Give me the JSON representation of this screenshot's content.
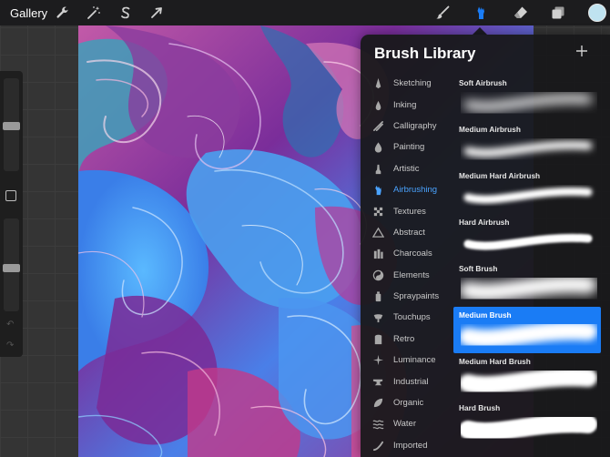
{
  "topbar": {
    "gallery_label": "Gallery",
    "actions_icons": [
      "wrench-icon",
      "magic-wand-icon",
      "selection-s-icon",
      "transform-arrow-icon"
    ],
    "tools_icons": [
      "brush-icon",
      "smudge-icon",
      "eraser-icon",
      "layers-icon"
    ],
    "active_tool": "smudge-icon",
    "accent_color": "#1a7cf5",
    "current_color": "#bfe3f0"
  },
  "panel": {
    "title": "Brush Library",
    "add_icon": "plus-icon",
    "sets": [
      {
        "label": "Sketching",
        "icon": "pencil-icon"
      },
      {
        "label": "Inking",
        "icon": "ink-drop-icon"
      },
      {
        "label": "Calligraphy",
        "icon": "calligraphy-icon"
      },
      {
        "label": "Painting",
        "icon": "paint-drop-icon"
      },
      {
        "label": "Artistic",
        "icon": "artistic-brush-icon"
      },
      {
        "label": "Airbrushing",
        "icon": "airbrush-icon",
        "active": true
      },
      {
        "label": "Textures",
        "icon": "texture-grid-icon"
      },
      {
        "label": "Abstract",
        "icon": "triangle-icon"
      },
      {
        "label": "Charcoals",
        "icon": "charcoal-icon"
      },
      {
        "label": "Elements",
        "icon": "yin-yang-icon"
      },
      {
        "label": "Spraypaints",
        "icon": "spray-can-icon"
      },
      {
        "label": "Touchups",
        "icon": "touchup-icon"
      },
      {
        "label": "Retro",
        "icon": "retro-icon"
      },
      {
        "label": "Luminance",
        "icon": "sparkle-icon"
      },
      {
        "label": "Industrial",
        "icon": "anvil-icon"
      },
      {
        "label": "Organic",
        "icon": "leaf-icon"
      },
      {
        "label": "Water",
        "icon": "waves-icon"
      },
      {
        "label": "Imported",
        "icon": "imported-stroke-icon"
      }
    ],
    "brushes": [
      {
        "name": "Soft Airbrush"
      },
      {
        "name": "Medium Airbrush"
      },
      {
        "name": "Medium Hard Airbrush"
      },
      {
        "name": "Hard Airbrush"
      },
      {
        "name": "Soft Brush"
      },
      {
        "name": "Medium Brush",
        "selected": true
      },
      {
        "name": "Medium Hard Brush"
      },
      {
        "name": "Hard Brush"
      }
    ]
  }
}
